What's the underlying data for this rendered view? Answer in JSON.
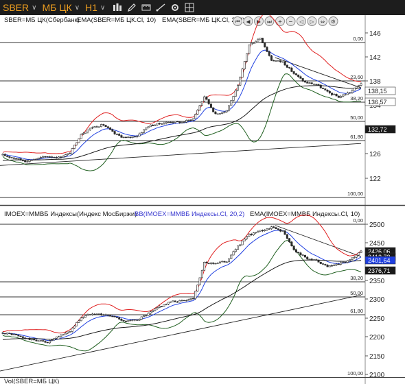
{
  "toolbar": {
    "symbol": "SBER",
    "board": "МБ ЦК",
    "timeframe": "H1",
    "icons": [
      "bars-chart-icon",
      "pencil-icon",
      "ruler-icon",
      "trendline-icon",
      "gear-icon",
      "crosshair-icon"
    ]
  },
  "navigation": {
    "buttons": [
      "first-icon",
      "prev-icon",
      "next-icon",
      "last-icon",
      "zoom-in-icon",
      "zoom-out-icon",
      "scroll-left-icon",
      "scroll-right-icon",
      "fit-icon",
      "settings-icon"
    ]
  },
  "panels": [
    {
      "legend": [
        {
          "text": "SBER=МБ ЦК(Сбербанк)",
          "color": "#1a1a1a"
        },
        {
          "text": "EMA(SBER=МБ ЦК.Cl, 10)",
          "color": "#1a1a1a"
        },
        {
          "text": "EMA(SBER=МБ ЦК.Cl, 200)",
          "color": "#1a1a1a"
        }
      ],
      "y_ticks": [
        "146",
        "142",
        "138",
        "134",
        "130",
        "126",
        "122"
      ],
      "fib_levels": [
        "0,00",
        "23,60",
        "38,20",
        "50,00",
        "61,80",
        "100,00"
      ],
      "price_tags": [
        {
          "text": "138,15",
          "bg": "#ffffff",
          "fg": "#1a1a1a"
        },
        {
          "text": "136,57",
          "bg": "#ffffff",
          "fg": "#1a1a1a"
        },
        {
          "text": "132,72",
          "bg": "#1a1a1a",
          "fg": "#ffffff"
        }
      ]
    },
    {
      "legend": [
        {
          "text": "IMOEX=ММВБ Индексы(Индекс МосБиржи)",
          "color": "#1a1a1a"
        },
        {
          "text": "BB(IMOEX=ММВБ Индексы.Cl, 20,2)",
          "color": "#3a3ad0"
        },
        {
          "text": "EMA(IMOEX=ММВБ Индексы.Cl, 10)",
          "color": "#1a1a1a"
        }
      ],
      "y_ticks": [
        "2500",
        "2450",
        "2400",
        "2350",
        "2300",
        "2250",
        "2200",
        "2150",
        "2100"
      ],
      "fib_levels": [
        "0,00",
        "38,20",
        "50,00",
        "61,80",
        "100,00"
      ],
      "price_tags": [
        {
          "text": "2426,06",
          "bg": "#1a1a1a",
          "fg": "#ffffff"
        },
        {
          "text": "2412,73",
          "bg": "#1a1a1a",
          "fg": "#ffffff"
        },
        {
          "text": "2401,64",
          "bg": "#2040e0",
          "fg": "#ffffff"
        },
        {
          "text": "2376,71",
          "bg": "#1a1a1a",
          "fg": "#ffffff"
        }
      ]
    },
    {
      "legend": [
        {
          "text": "Vol(SBER=МБ ЦК)",
          "color": "#1a1a1a"
        }
      ]
    }
  ],
  "colors": {
    "toolbar_bg": "#1d1d1d",
    "accent": "#f0a020",
    "upper_band": "#e02020",
    "lower_band": "#1f5f1f",
    "ema_short": "#2040e0",
    "ema_long": "#1a1a1a",
    "candle": "#2a2a2a"
  },
  "chart_data": [
    {
      "type": "candlestick",
      "title": "SBER=МБ ЦК(Сбербанк)",
      "ylim": [
        122,
        148
      ],
      "yticks": [
        146,
        142,
        138,
        134,
        130,
        126,
        122
      ],
      "fib_levels": {
        "0,00": 145.8,
        "23,60": 140.2,
        "38,20": 136.8,
        "50,00": 134.0,
        "61,80": 131.3,
        "100,00": 122.6
      },
      "last_values": {
        "upper_band": 138.15,
        "ema_10": 136.57,
        "ema_200": 132.72
      },
      "path": [
        [
          0,
          125.8
        ],
        [
          5,
          125.3
        ],
        [
          10,
          124.8
        ],
        [
          15,
          125.2
        ],
        [
          20,
          125.6
        ],
        [
          25,
          125.4
        ],
        [
          30,
          126.1
        ],
        [
          35,
          129.3
        ],
        [
          40,
          130.4
        ],
        [
          45,
          130.8
        ],
        [
          50,
          129.3
        ],
        [
          55,
          128.6
        ],
        [
          60,
          129.0
        ],
        [
          65,
          130.6
        ],
        [
          70,
          131.0
        ],
        [
          75,
          131.3
        ],
        [
          80,
          131.2
        ],
        [
          85,
          131.8
        ],
        [
          90,
          135.5
        ],
        [
          95,
          132.5
        ],
        [
          100,
          133.2
        ],
        [
          105,
          137.2
        ],
        [
          110,
          144.0
        ],
        [
          115,
          145.2
        ],
        [
          120,
          141.5
        ],
        [
          125,
          141.2
        ],
        [
          130,
          139.3
        ],
        [
          135,
          137.8
        ],
        [
          140,
          137.5
        ],
        [
          145,
          136.2
        ],
        [
          150,
          135.4
        ],
        [
          155,
          136.2
        ],
        [
          160,
          137.7
        ]
      ]
    },
    {
      "type": "candlestick",
      "title": "IMOEX=ММВБ Индексы(Индекс МосБиржи)",
      "ylim": [
        2100,
        2520
      ],
      "yticks": [
        2500,
        2450,
        2400,
        2350,
        2300,
        2250,
        2200,
        2150,
        2100
      ],
      "fib_levels": {
        "0,00": 2495,
        "38,20": 2350,
        "50,00": 2305,
        "61,80": 2260,
        "100,00": 2115
      },
      "last_values": {
        "upper_band": 2426.06,
        "ema_10": 2412.73,
        "bb_mid": 2401.64,
        "lower_band": 2376.71
      },
      "path": [
        [
          0,
          2210
        ],
        [
          5,
          2205
        ],
        [
          10,
          2195
        ],
        [
          15,
          2190
        ],
        [
          20,
          2185
        ],
        [
          25,
          2200
        ],
        [
          30,
          2215
        ],
        [
          35,
          2250
        ],
        [
          40,
          2262
        ],
        [
          45,
          2258
        ],
        [
          50,
          2252
        ],
        [
          55,
          2240
        ],
        [
          60,
          2245
        ],
        [
          65,
          2260
        ],
        [
          70,
          2280
        ],
        [
          75,
          2292
        ],
        [
          80,
          2295
        ],
        [
          85,
          2302
        ],
        [
          90,
          2395
        ],
        [
          95,
          2395
        ],
        [
          100,
          2400
        ],
        [
          105,
          2440
        ],
        [
          110,
          2470
        ],
        [
          115,
          2480
        ],
        [
          120,
          2490
        ],
        [
          125,
          2480
        ],
        [
          130,
          2430
        ],
        [
          135,
          2410
        ],
        [
          140,
          2400
        ],
        [
          145,
          2385
        ],
        [
          150,
          2392
        ],
        [
          155,
          2402
        ],
        [
          160,
          2425
        ]
      ]
    }
  ]
}
